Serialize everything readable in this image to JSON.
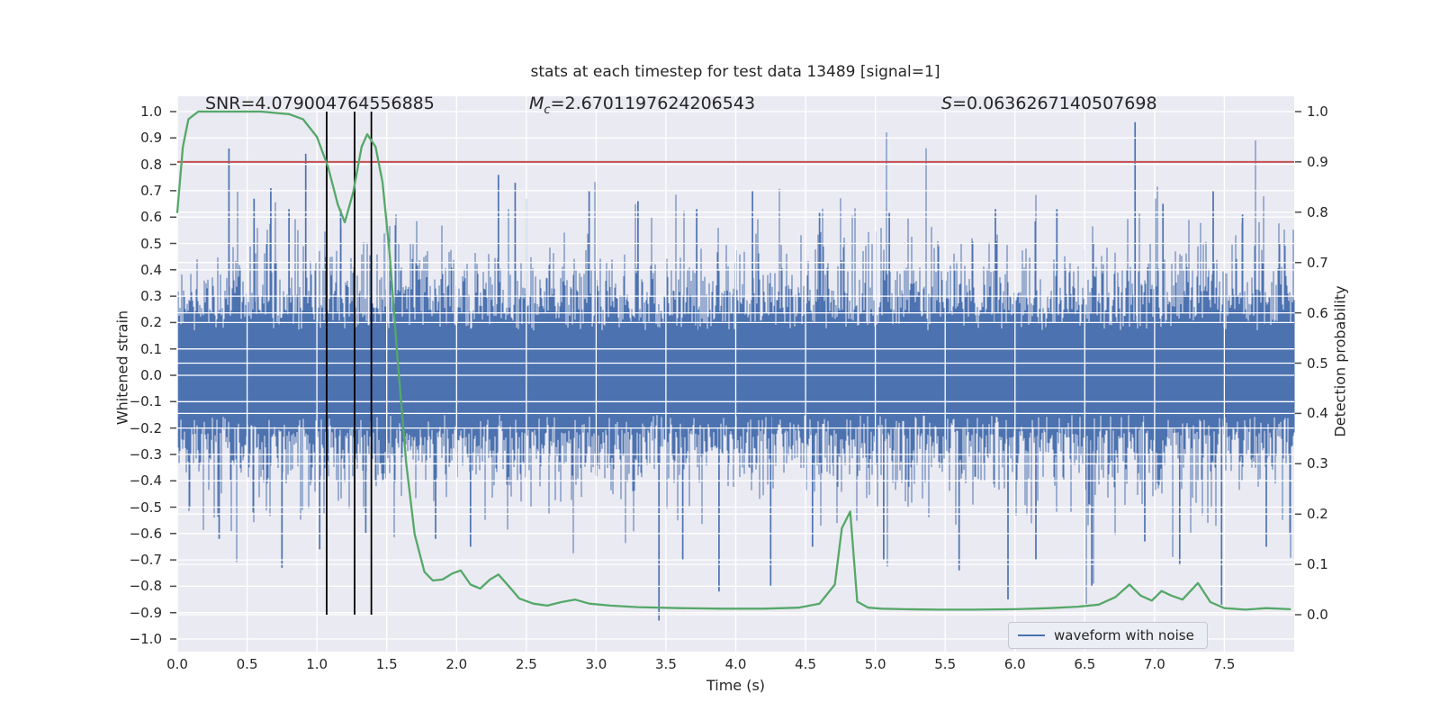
{
  "title": "stats at each timestep for test data 13489 [signal=1]",
  "eq": "=",
  "stats": [
    {
      "label": "SNR",
      "sub": "",
      "value": "4.079004764556885"
    },
    {
      "label": "M",
      "sub": "c",
      "value": "2.6701197624206543"
    },
    {
      "label": "S",
      "sub": "",
      "value": "0.0636267140507698"
    }
  ],
  "axes": {
    "x": {
      "label": "Time (s)",
      "range": [
        0,
        8
      ],
      "ticks": [
        0.0,
        0.5,
        1.0,
        1.5,
        2.0,
        2.5,
        3.0,
        3.5,
        4.0,
        4.5,
        5.0,
        5.5,
        6.0,
        6.5,
        7.0,
        7.5
      ]
    },
    "y_left": {
      "label": "Whitened strain",
      "range": [
        -1.05,
        1.05
      ],
      "ticks": [
        1.0,
        0.9,
        0.8,
        0.7,
        0.6,
        0.5,
        0.4,
        0.3,
        0.2,
        0.1,
        0.0,
        -0.1,
        -0.2,
        -0.3,
        -0.4,
        -0.5,
        -0.6,
        -0.7,
        -0.8,
        -0.9,
        -1.0
      ]
    },
    "y_right": {
      "label": "Detection probability",
      "range": [
        -0.07,
        1.03
      ],
      "ticks": [
        1.0,
        0.9,
        0.8,
        0.7,
        0.6,
        0.5,
        0.4,
        0.3,
        0.2,
        0.1,
        0.0
      ]
    }
  },
  "legend": {
    "items": [
      {
        "label": "waveform with noise",
        "color": "#4c72b0"
      }
    ]
  },
  "colors": {
    "plot_bg": "#eaeaf2",
    "grid": "#ffffff",
    "waveform": "#4c72b0",
    "probability": "#55a868",
    "threshold": "#c44e52",
    "marker": "#000000",
    "text": "#262626"
  },
  "chart_data": {
    "type": "line",
    "title": "stats at each timestep for test data 13489 [signal=1]",
    "xlabel": "Time (s)",
    "x_range": [
      0,
      8
    ],
    "grid": true,
    "legend_position": "lower right",
    "series": [
      {
        "name": "waveform with noise",
        "axis": "left",
        "kind": "noise_envelope",
        "color": "#4c72b0",
        "sigma": 0.2,
        "band": 0.2,
        "seed": 20489,
        "spikes": [
          [
            0.3,
            -0.62
          ],
          [
            0.37,
            0.86
          ],
          [
            0.55,
            0.67
          ],
          [
            0.67,
            0.71
          ],
          [
            0.75,
            -0.73
          ],
          [
            0.8,
            0.63
          ],
          [
            0.92,
            0.84
          ],
          [
            1.02,
            -0.66
          ],
          [
            1.07,
            0.76
          ],
          [
            1.17,
            0.63
          ],
          [
            1.35,
            -0.6
          ],
          [
            1.5,
            0.6
          ],
          [
            1.85,
            -0.62
          ],
          [
            2.1,
            -0.65
          ],
          [
            2.3,
            0.76
          ],
          [
            2.42,
            0.73
          ],
          [
            2.5,
            0.67
          ],
          [
            2.95,
            0.7
          ],
          [
            3.3,
            0.66
          ],
          [
            3.45,
            -0.93
          ],
          [
            3.62,
            -0.7
          ],
          [
            3.72,
            0.63
          ],
          [
            3.88,
            -0.82
          ],
          [
            4.12,
            0.7
          ],
          [
            4.25,
            -0.8
          ],
          [
            4.55,
            -0.65
          ],
          [
            4.6,
            0.62
          ],
          [
            5.06,
            -0.7
          ],
          [
            5.1,
            0.62
          ],
          [
            5.6,
            -0.74
          ],
          [
            5.86,
            0.63
          ],
          [
            5.95,
            -0.85
          ],
          [
            6.15,
            -0.7
          ],
          [
            6.3,
            0.63
          ],
          [
            6.55,
            -0.8
          ],
          [
            6.86,
            0.96
          ],
          [
            6.93,
            -0.63
          ],
          [
            7.06,
            0.65
          ],
          [
            7.18,
            -0.72
          ],
          [
            7.42,
            0.7
          ],
          [
            7.48,
            -0.87
          ],
          [
            7.63,
            0.61
          ],
          [
            7.8,
            -0.65
          ]
        ]
      },
      {
        "name": "detection probability",
        "axis": "right",
        "kind": "line",
        "color": "#55a868",
        "points": [
          [
            0.0,
            0.8
          ],
          [
            0.04,
            0.93
          ],
          [
            0.08,
            0.985
          ],
          [
            0.15,
            1.0
          ],
          [
            0.6,
            1.0
          ],
          [
            0.8,
            0.995
          ],
          [
            0.9,
            0.985
          ],
          [
            1.0,
            0.95
          ],
          [
            1.08,
            0.89
          ],
          [
            1.15,
            0.815
          ],
          [
            1.2,
            0.78
          ],
          [
            1.26,
            0.84
          ],
          [
            1.32,
            0.93
          ],
          [
            1.36,
            0.955
          ],
          [
            1.42,
            0.93
          ],
          [
            1.47,
            0.86
          ],
          [
            1.52,
            0.72
          ],
          [
            1.58,
            0.5
          ],
          [
            1.64,
            0.3
          ],
          [
            1.7,
            0.16
          ],
          [
            1.77,
            0.085
          ],
          [
            1.83,
            0.068
          ],
          [
            1.9,
            0.07
          ],
          [
            1.97,
            0.082
          ],
          [
            2.03,
            0.088
          ],
          [
            2.1,
            0.06
          ],
          [
            2.17,
            0.052
          ],
          [
            2.24,
            0.07
          ],
          [
            2.3,
            0.08
          ],
          [
            2.38,
            0.055
          ],
          [
            2.45,
            0.032
          ],
          [
            2.55,
            0.022
          ],
          [
            2.65,
            0.018
          ],
          [
            2.75,
            0.025
          ],
          [
            2.85,
            0.03
          ],
          [
            2.95,
            0.022
          ],
          [
            3.1,
            0.018
          ],
          [
            3.3,
            0.015
          ],
          [
            3.6,
            0.013
          ],
          [
            3.9,
            0.012
          ],
          [
            4.2,
            0.012
          ],
          [
            4.45,
            0.014
          ],
          [
            4.6,
            0.022
          ],
          [
            4.71,
            0.06
          ],
          [
            4.76,
            0.172
          ],
          [
            4.82,
            0.205
          ],
          [
            4.87,
            0.026
          ],
          [
            4.95,
            0.014
          ],
          [
            5.05,
            0.012
          ],
          [
            5.2,
            0.011
          ],
          [
            5.45,
            0.01
          ],
          [
            5.7,
            0.01
          ],
          [
            6.0,
            0.011
          ],
          [
            6.25,
            0.013
          ],
          [
            6.45,
            0.016
          ],
          [
            6.6,
            0.02
          ],
          [
            6.72,
            0.035
          ],
          [
            6.82,
            0.06
          ],
          [
            6.9,
            0.038
          ],
          [
            6.98,
            0.028
          ],
          [
            7.05,
            0.047
          ],
          [
            7.12,
            0.038
          ],
          [
            7.2,
            0.03
          ],
          [
            7.31,
            0.063
          ],
          [
            7.4,
            0.025
          ],
          [
            7.5,
            0.013
          ],
          [
            7.65,
            0.01
          ],
          [
            7.8,
            0.013
          ],
          [
            7.97,
            0.011
          ]
        ]
      },
      {
        "name": "threshold",
        "axis": "right",
        "kind": "hline",
        "color": "#c44e52",
        "y": 0.9
      },
      {
        "name": "event markers",
        "axis": "right",
        "kind": "vlines",
        "color": "#000000",
        "x": [
          1.07,
          1.27,
          1.39
        ],
        "span": [
          0.0,
          1.0
        ]
      }
    ]
  }
}
